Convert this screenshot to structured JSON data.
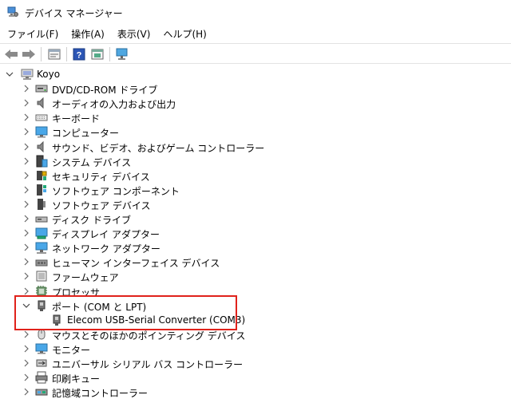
{
  "window": {
    "title": "デバイス マネージャー",
    "icon": "device-manager-icon"
  },
  "menu": [
    "ファイル(F)",
    "操作(A)",
    "表示(V)",
    "ヘルプ(H)"
  ],
  "toolbar": [
    "back-arrow-icon",
    "forward-arrow-icon",
    "properties-icon",
    "help-icon",
    "update-driver-icon",
    "monitor-scan-icon"
  ],
  "tree": {
    "root": "Koyo",
    "categories": [
      {
        "label": "DVD/CD-ROM ドライブ",
        "icon": "dvd-drive-icon"
      },
      {
        "label": "オーディオの入力および出力",
        "icon": "speaker-icon"
      },
      {
        "label": "キーボード",
        "icon": "keyboard-icon"
      },
      {
        "label": "コンピューター",
        "icon": "computer-icon"
      },
      {
        "label": "サウンド、ビデオ、およびゲーム コントローラー",
        "icon": "speaker-icon"
      },
      {
        "label": "システム デバイス",
        "icon": "system-devices-icon"
      },
      {
        "label": "セキュリティ デバイス",
        "icon": "security-device-icon"
      },
      {
        "label": "ソフトウェア コンポーネント",
        "icon": "software-component-icon"
      },
      {
        "label": "ソフトウェア デバイス",
        "icon": "software-device-icon"
      },
      {
        "label": "ディスク ドライブ",
        "icon": "disk-drive-icon"
      },
      {
        "label": "ディスプレイ アダプター",
        "icon": "display-adapter-icon"
      },
      {
        "label": "ネットワーク アダプター",
        "icon": "network-adapter-icon"
      },
      {
        "label": "ヒューマン インターフェイス デバイス",
        "icon": "hid-icon"
      },
      {
        "label": "ファームウェア",
        "icon": "firmware-icon"
      },
      {
        "label": "プロセッサ",
        "icon": "processor-icon"
      },
      {
        "label": "ポート (COM と LPT)",
        "icon": "port-icon",
        "expanded": true,
        "children": [
          {
            "label": "Elecom USB-Serial Converter (COM3)",
            "icon": "port-icon"
          }
        ]
      },
      {
        "label": "マウスとそのほかのポインティング デバイス",
        "icon": "mouse-icon"
      },
      {
        "label": "モニター",
        "icon": "monitor-icon"
      },
      {
        "label": "ユニバーサル シリアル バス コントローラー",
        "icon": "usb-icon"
      },
      {
        "label": "印刷キュー",
        "icon": "printer-icon"
      },
      {
        "label": "記憶域コントローラー",
        "icon": "storage-controller-icon"
      }
    ]
  },
  "colors": {
    "highlight": "#e0221b"
  }
}
